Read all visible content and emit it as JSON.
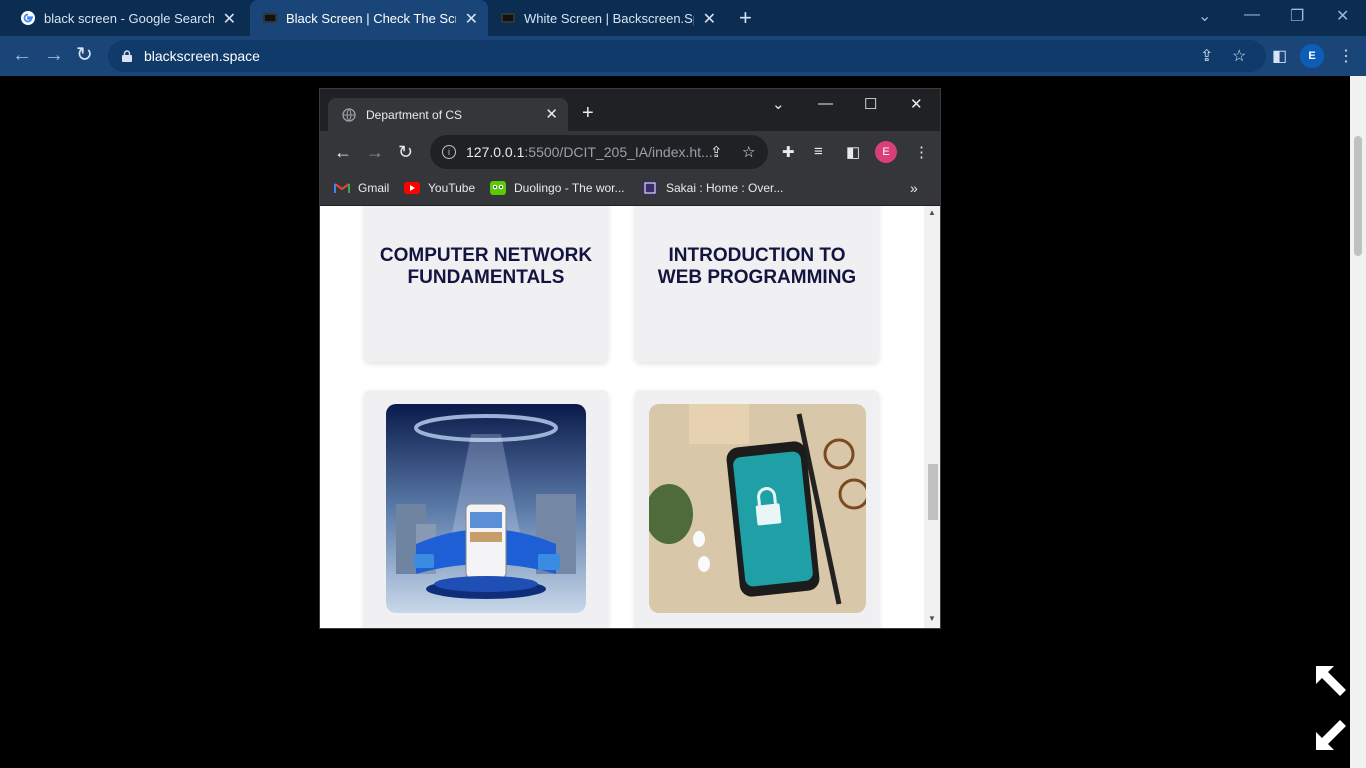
{
  "outer_browser": {
    "tabs": [
      {
        "title": "black screen - Google Search",
        "favicon": "google-g-icon"
      },
      {
        "title": "Black Screen | Check The Screen",
        "favicon": "blackscreen-favicon"
      },
      {
        "title": "White Screen | Backscreen.Space",
        "favicon": "blackscreen-favicon"
      }
    ],
    "address": "blackscreen.space",
    "profile_initial": "E"
  },
  "inner_browser": {
    "tab_title": "Department of CS",
    "address_host": "127.0.0.1",
    "address_path": ":5500/DCIT_205_IA/index.ht...",
    "profile_initial": "E",
    "bookmarks": [
      {
        "label": "Gmail",
        "icon": "gmail-icon"
      },
      {
        "label": "YouTube",
        "icon": "youtube-icon"
      },
      {
        "label": "Duolingo - The wor...",
        "icon": "duolingo-icon"
      },
      {
        "label": "Sakai : Home : Over...",
        "icon": "sakai-icon"
      }
    ],
    "more_bookmarks": "»"
  },
  "page": {
    "cards": [
      {
        "title_line1": "COMPUTER NETWORK",
        "title_line2": "FUNDAMENTALS"
      },
      {
        "title_line1": "INTRODUCTION TO",
        "title_line2": "WEB PROGRAMMING"
      }
    ],
    "images": [
      {
        "subject": "mobile-app-stage-image"
      },
      {
        "subject": "phone-security-lock-image"
      }
    ]
  },
  "colors": {
    "outer_tabbar": "#0b2d52",
    "outer_toolbar": "#1a4579",
    "card_title": "#141440",
    "inner_avatar": "#d93f7b"
  }
}
